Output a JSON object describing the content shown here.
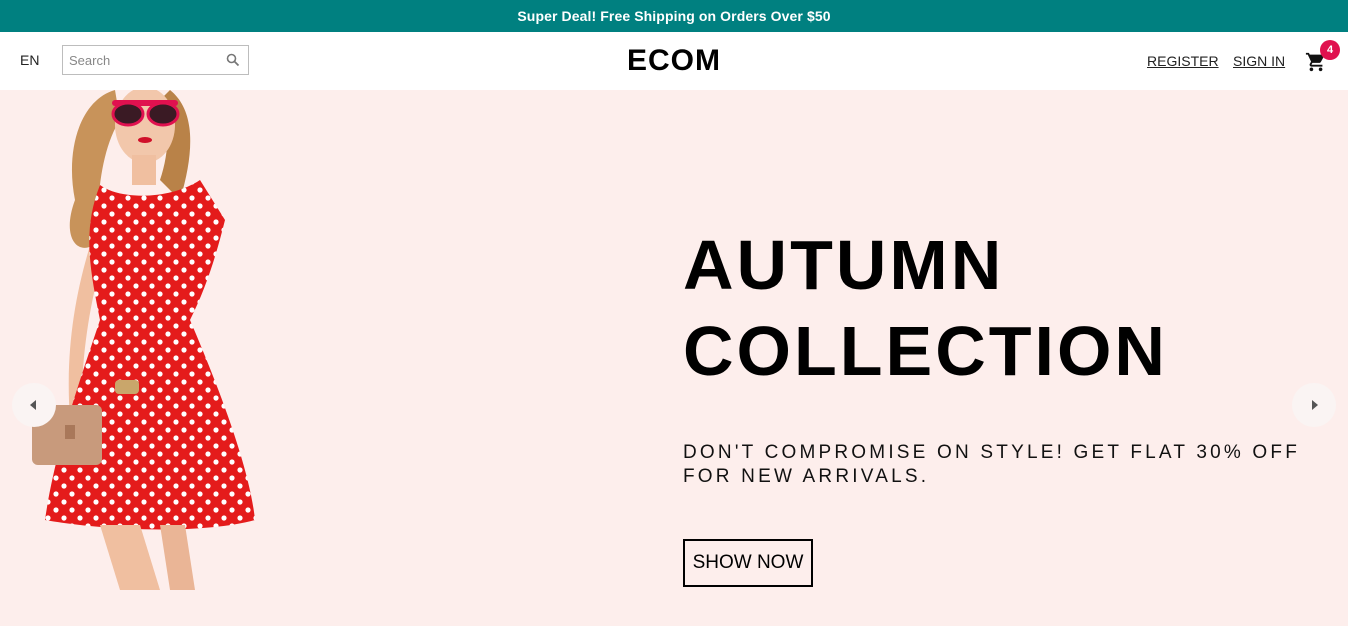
{
  "announcement": {
    "text": "Super Deal! Free Shipping on Orders Over $50",
    "bg_color": "#008080"
  },
  "navbar": {
    "language": "EN",
    "search": {
      "placeholder": "Search",
      "value": "",
      "icon": "search-icon"
    },
    "logo": "ECOM",
    "links": {
      "register": "REGISTER",
      "sign_in": "SIGN IN"
    },
    "cart": {
      "icon": "shopping-cart-icon",
      "count": "4",
      "badge_color": "#e0114f"
    }
  },
  "hero": {
    "bg_color": "#fdeeec",
    "title": "AUTUMN\nCOLLECTION",
    "description": "DON'T COMPROMISE ON STYLE! GET FLAT 30% OFF FOR NEW ARRIVALS.",
    "button_label": "SHOW NOW",
    "arrows": {
      "left": "chevron-left-icon",
      "right": "chevron-right-icon"
    },
    "image": "woman-in-red-polka-dot-dress"
  }
}
